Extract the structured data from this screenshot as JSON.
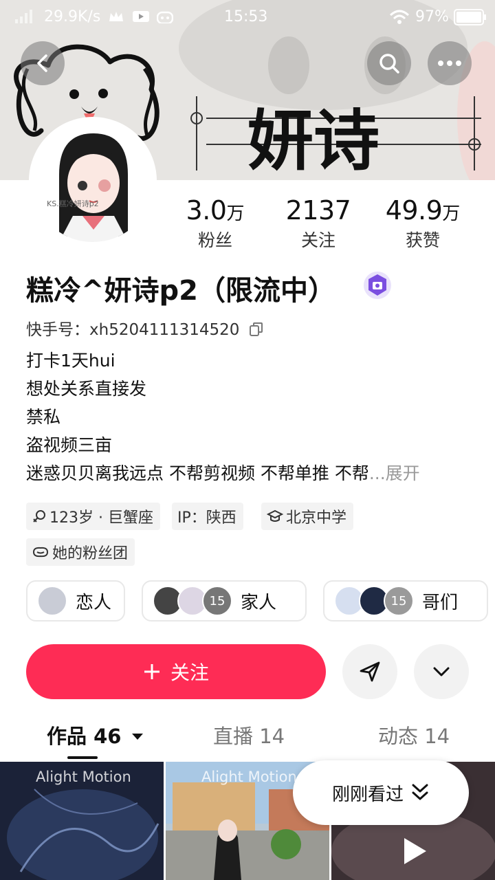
{
  "status_bar": {
    "speed": "29.9K/s",
    "time": "15:53",
    "battery": "97%"
  },
  "banner": {
    "title_text": "妍诗"
  },
  "avatar": {
    "caption": "KS.糕冷妍诗p2"
  },
  "stats": [
    {
      "value": "3.0",
      "unit": "万",
      "label": "粉丝"
    },
    {
      "value": "2137",
      "unit": "",
      "label": "关注"
    },
    {
      "value": "49.9",
      "unit": "万",
      "label": "获赞"
    }
  ],
  "profile": {
    "name": "糕冷^妍诗p2（限流中）",
    "kuaishou_id": "快手号：xh5204111314520",
    "bio_lines": [
      "打卡1天hui",
      "想处关系直接发",
      "禁私",
      "盗视频三亩"
    ],
    "bio_last": "迷惑贝贝离我远点 不帮剪视频 不帮单推 不帮",
    "bio_more": "...展开"
  },
  "tags": {
    "age": "123岁 · 巨蟹座",
    "ip": "IP：陕西",
    "school": "北京中学",
    "fan_club": "她的粉丝团"
  },
  "relations": [
    {
      "label": "恋人",
      "count": ""
    },
    {
      "label": "家人",
      "count": "15"
    },
    {
      "label": "哥们",
      "count": "15"
    }
  ],
  "actions": {
    "follow": "关注"
  },
  "tabs": {
    "works": "作品 46",
    "live": "直播 14",
    "dynamic": "动态 14"
  },
  "thumbs": {
    "watermark": "Alight Motion"
  },
  "recent": {
    "label": "刚刚看过"
  },
  "colors": {
    "accent": "#fe2c55",
    "badge": "#7b4fe0"
  }
}
